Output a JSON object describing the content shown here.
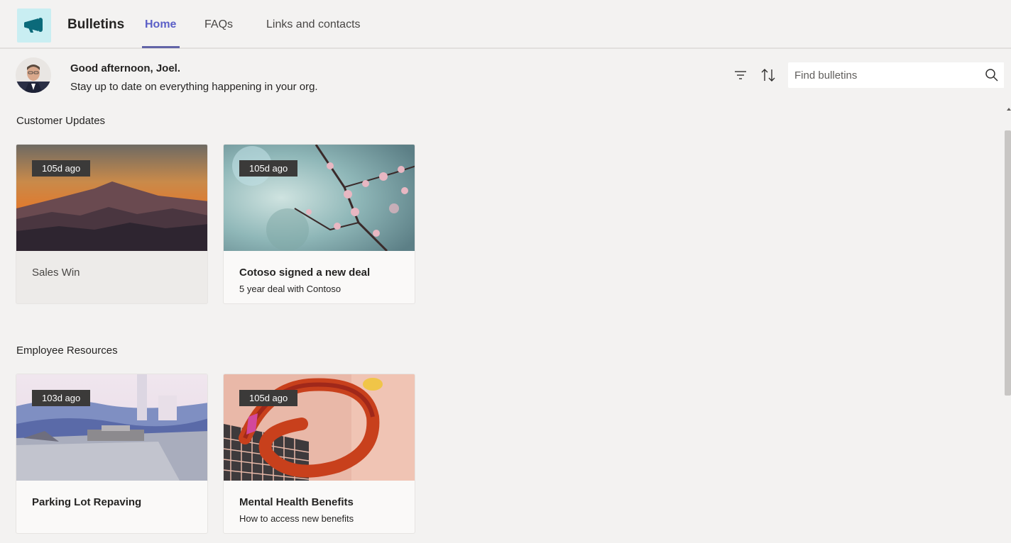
{
  "app": {
    "title": "Bulletins",
    "logo_icon": "megaphone-icon",
    "accent_color": "#6264a7",
    "logo_bg": "#c9eef2"
  },
  "tabs": [
    {
      "label": "Home",
      "active": true
    },
    {
      "label": "FAQs",
      "active": false
    },
    {
      "label": "Links and contacts",
      "active": false
    }
  ],
  "greeting": {
    "title": "Good afternoon, Joel.",
    "subtitle": "Stay up to date on everything happening in your org."
  },
  "toolbar": {
    "filter_icon": "filter-icon",
    "sort_icon": "sort-icon",
    "search_placeholder": "Find bulletins",
    "search_icon": "search-icon"
  },
  "sections": [
    {
      "title": "Customer Updates",
      "cards": [
        {
          "badge": "105d ago",
          "title": "Sales Win",
          "subtitle": ""
        },
        {
          "badge": "105d ago",
          "title": "Cotoso signed a new deal",
          "subtitle": "5 year deal with Contoso"
        }
      ]
    },
    {
      "title": "Employee Resources",
      "cards": [
        {
          "badge": "103d ago",
          "title": "Parking Lot Repaving",
          "subtitle": ""
        },
        {
          "badge": "105d ago",
          "title": "Mental Health Benefits",
          "subtitle": "How to access new benefits"
        }
      ]
    }
  ]
}
